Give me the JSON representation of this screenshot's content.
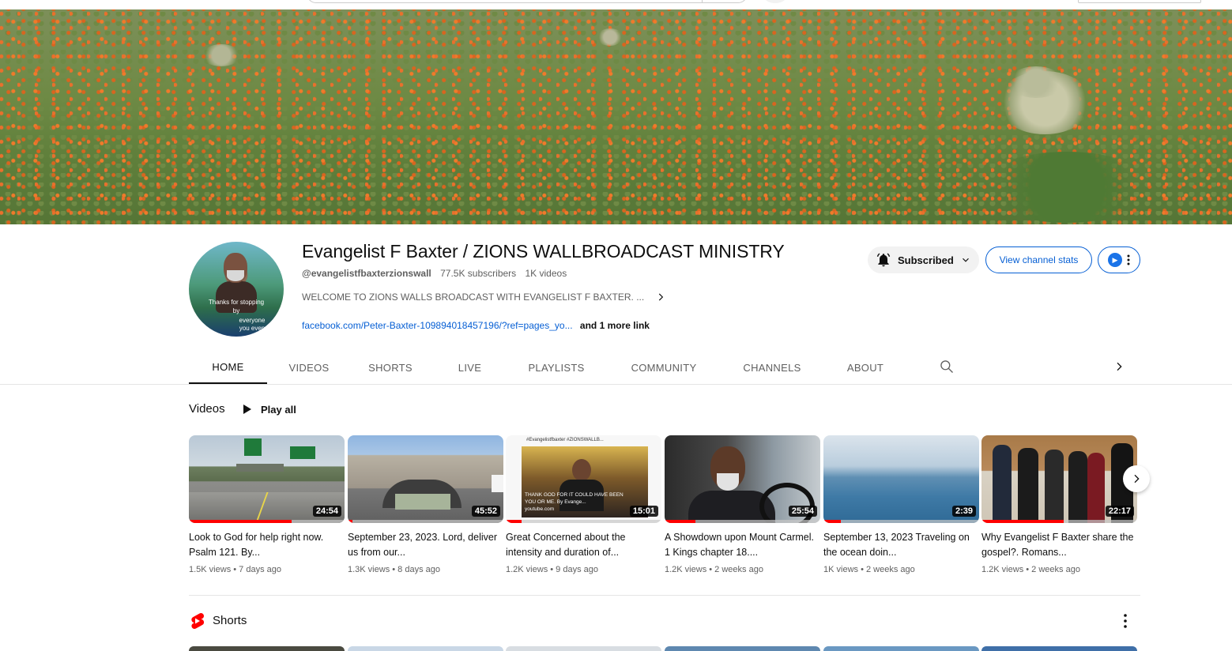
{
  "channel": {
    "name": "Evangelist F Baxter / ZIONS WALLBROADCAST MINISTRY",
    "handle": "@evangelistfbaxterzionswall",
    "subscribers": "77.5K subscribers",
    "video_count": "1K videos",
    "description": "WELCOME TO ZIONS WALLS BROADCAST WITH EVANGELIST F BAXTER. ...",
    "link": "facebook.com/Peter-Baxter-109894018457196/?ref=pages_yo...",
    "more_links": "and 1 more link",
    "avatar_overlay": [
      "Thanks for stopping",
      "by",
      "everyone",
      "you even"
    ]
  },
  "actions": {
    "subscribed_label": "Subscribed",
    "stats_label": "View channel stats",
    "accent": "#065fd4"
  },
  "tabs": [
    {
      "label": "HOME",
      "active": true
    },
    {
      "label": "VIDEOS"
    },
    {
      "label": "SHORTS"
    },
    {
      "label": "LIVE"
    },
    {
      "label": "PLAYLISTS"
    },
    {
      "label": "COMMUNITY"
    },
    {
      "label": "CHANNELS"
    },
    {
      "label": "ABOUT"
    }
  ],
  "videos_shelf": {
    "title": "Videos",
    "play_all": "Play all",
    "items": [
      {
        "title": "Look to God for help right now. Psalm 121. By...",
        "views": "1.5K views",
        "age": "7 days ago",
        "duration": "24:54",
        "watched": 0.66
      },
      {
        "title": "September 23, 2023. Lord, deliver us from our...",
        "views": "1.3K views",
        "age": "8 days ago",
        "duration": "45:52",
        "watched": 0.03
      },
      {
        "title": "Great Concerned about the intensity and duration of...",
        "views": "1.2K views",
        "age": "9 days ago",
        "duration": "15:01",
        "watched": 0.1,
        "overlay_text": [
          "#Evangelistfbaxter  #ZIONSWALLB...",
          "THANK GOD FOR IT COULD HAVE BEEN",
          "YOU OR ME. By Evange...",
          "youtube.com"
        ]
      },
      {
        "title": "A Showdown upon Mount Carmel. 1 Kings chapter 18....",
        "views": "1.2K views",
        "age": "2 weeks ago",
        "duration": "25:54",
        "watched": 0.2
      },
      {
        "title": "September 13, 2023 Traveling on the ocean doin...",
        "views": "1K views",
        "age": "2 weeks ago",
        "duration": "2:39",
        "watched": 0.11
      },
      {
        "title": "Why Evangelist F Baxter share the gospel?. Romans...",
        "views": "1.2K views",
        "age": "2 weeks ago",
        "duration": "22:17",
        "watched": 0.53
      }
    ]
  },
  "shorts_shelf": {
    "title": "Shorts"
  },
  "colors": {
    "progress": "#ff0000",
    "shorts_red": "#ff0000"
  }
}
